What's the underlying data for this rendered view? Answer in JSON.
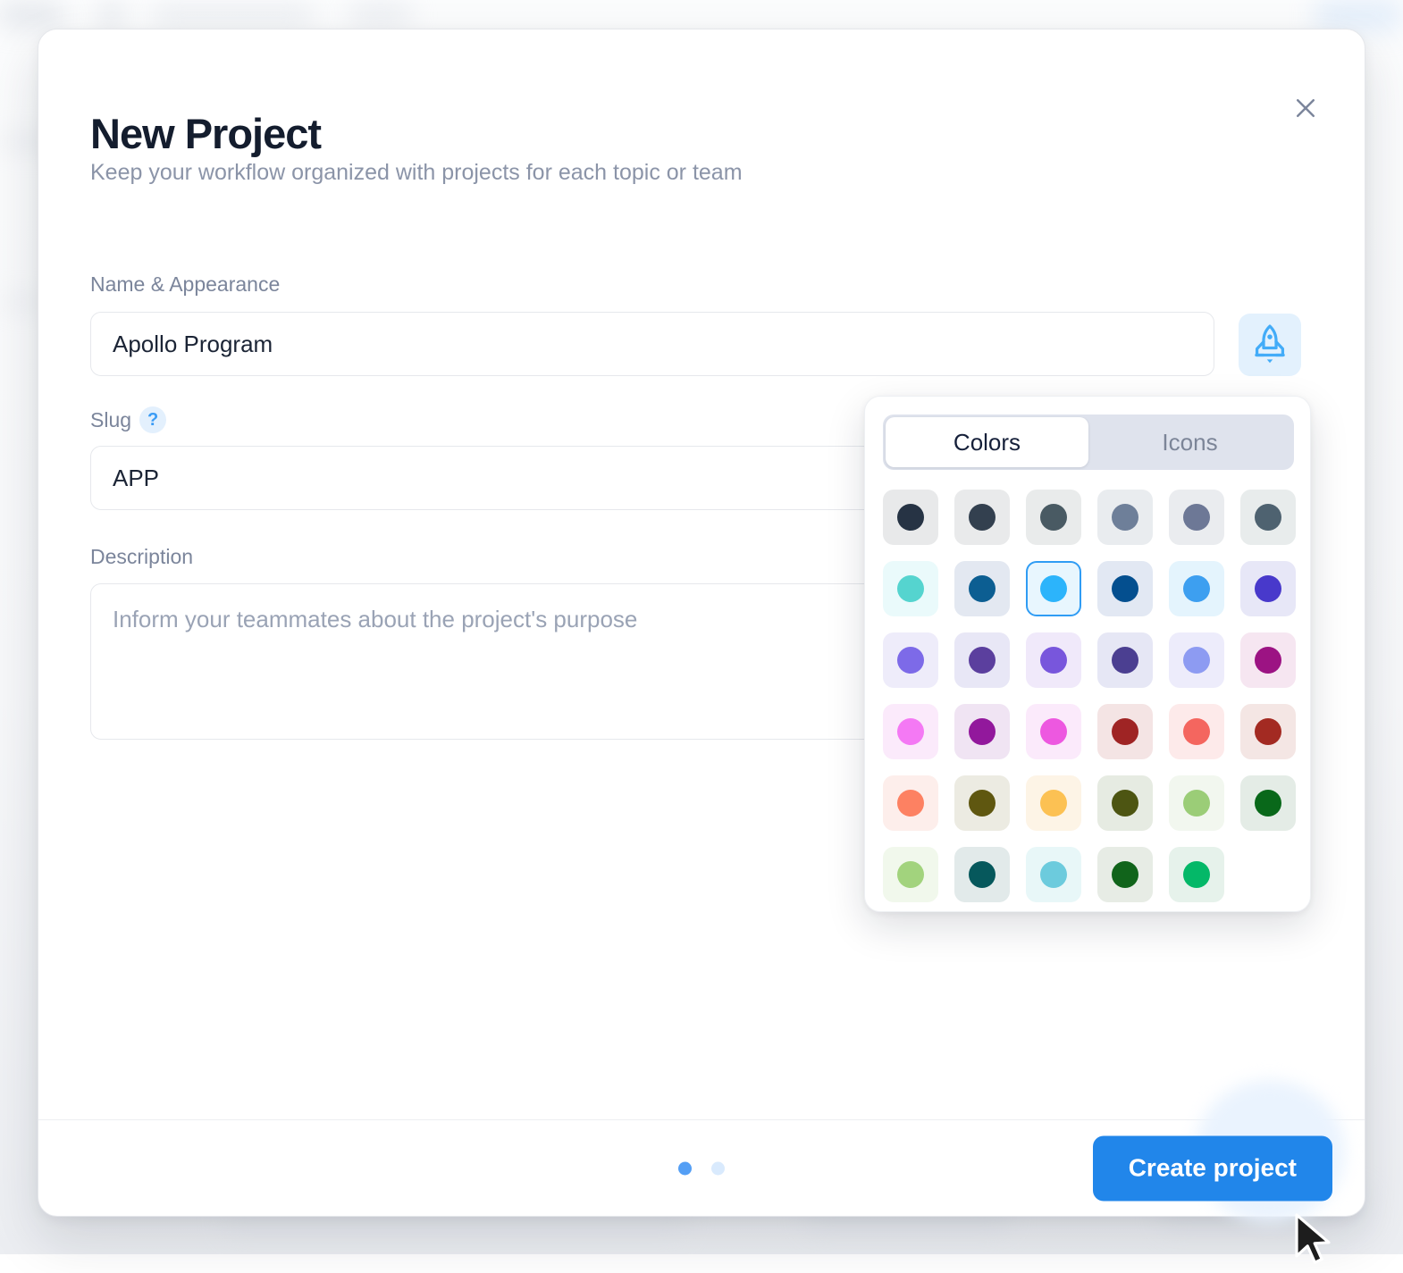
{
  "modal": {
    "title": "New Project",
    "subtitle": "Keep your workflow organized with projects for each topic or team",
    "close_icon": "close-icon"
  },
  "form": {
    "name": {
      "label": "Name & Appearance",
      "value": "Apollo Program",
      "placeholder": ""
    },
    "slug": {
      "label": "Slug",
      "help_glyph": "?",
      "value": "APP",
      "placeholder": ""
    },
    "description": {
      "label": "Description",
      "value": "",
      "placeholder": "Inform your teammates about the project's purpose"
    },
    "appearance_button": {
      "icon": "rocket-icon",
      "background": "#e3f1fd",
      "color": "#43acf8"
    }
  },
  "popover": {
    "tabs": [
      {
        "label": "Colors",
        "active": true
      },
      {
        "label": "Icons",
        "active": false
      }
    ],
    "selected_color": "#2cb4fb",
    "selection_ring": "#2f9cf4",
    "colors": [
      {
        "dot": "#263344",
        "bg": "#e8e9ea",
        "selected": false
      },
      {
        "dot": "#33404f",
        "bg": "#e9eaeb",
        "selected": false
      },
      {
        "dot": "#495a63",
        "bg": "#e9ebeb",
        "selected": false
      },
      {
        "dot": "#6e7f99",
        "bg": "#e9ecef",
        "selected": false
      },
      {
        "dot": "#6d7896",
        "bg": "#eaecef",
        "selected": false
      },
      {
        "dot": "#4e6270",
        "bg": "#e8ecec",
        "selected": false
      },
      {
        "dot": "#55d4cf",
        "bg": "#eafafb",
        "selected": false
      },
      {
        "dot": "#0c5e92",
        "bg": "#e3e8f1",
        "selected": false
      },
      {
        "dot": "#2cb4fb",
        "bg": "#e8f6fe",
        "selected": true
      },
      {
        "dot": "#044f8f",
        "bg": "#e2e8f3",
        "selected": false
      },
      {
        "dot": "#3d9ff0",
        "bg": "#e4f4fd",
        "selected": false
      },
      {
        "dot": "#4839cb",
        "bg": "#e7e7f7",
        "selected": false
      },
      {
        "dot": "#7d6ae8",
        "bg": "#eeecfa",
        "selected": false
      },
      {
        "dot": "#5b3f9e",
        "bg": "#e8e7f6",
        "selected": false
      },
      {
        "dot": "#7856dc",
        "bg": "#f0e9fa",
        "selected": false
      },
      {
        "dot": "#4b3f91",
        "bg": "#e6e7f5",
        "selected": false
      },
      {
        "dot": "#8d9bf2",
        "bg": "#edecfb",
        "selected": false
      },
      {
        "dot": "#9c1383",
        "bg": "#f6e6f1",
        "selected": false
      },
      {
        "dot": "#f479f4",
        "bg": "#fbeafb",
        "selected": false
      },
      {
        "dot": "#92189c",
        "bg": "#f0e4f3",
        "selected": false
      },
      {
        "dot": "#ed58e0",
        "bg": "#fbeafb",
        "selected": false
      },
      {
        "dot": "#9f2424",
        "bg": "#f4e4e4",
        "selected": false
      },
      {
        "dot": "#f4665f",
        "bg": "#fdeaea",
        "selected": false
      },
      {
        "dot": "#a32a22",
        "bg": "#f4e6e4",
        "selected": false
      },
      {
        "dot": "#fd8162",
        "bg": "#fdeeeb",
        "selected": false
      },
      {
        "dot": "#5f5710",
        "bg": "#ecebe2",
        "selected": false
      },
      {
        "dot": "#fcc153",
        "bg": "#fdf4e6",
        "selected": false
      },
      {
        "dot": "#4d5512",
        "bg": "#e6ebe2",
        "selected": false
      },
      {
        "dot": "#9bcd77",
        "bg": "#f2f7ef",
        "selected": false
      },
      {
        "dot": "#09681a",
        "bg": "#e4ece6",
        "selected": false
      },
      {
        "dot": "#a2d37d",
        "bg": "#f1f8ec",
        "selected": false
      },
      {
        "dot": "#06585c",
        "bg": "#e2eaea",
        "selected": false
      },
      {
        "dot": "#6ccbdd",
        "bg": "#e8f7f8",
        "selected": false
      },
      {
        "dot": "#11641b",
        "bg": "#e7ece5",
        "selected": false
      },
      {
        "dot": "#04b868",
        "bg": "#e6f2eb",
        "selected": false
      }
    ]
  },
  "footer": {
    "dots": [
      {
        "active": true
      },
      {
        "active": false
      }
    ],
    "create_label": "Create project",
    "create_color": "#2186ea"
  }
}
